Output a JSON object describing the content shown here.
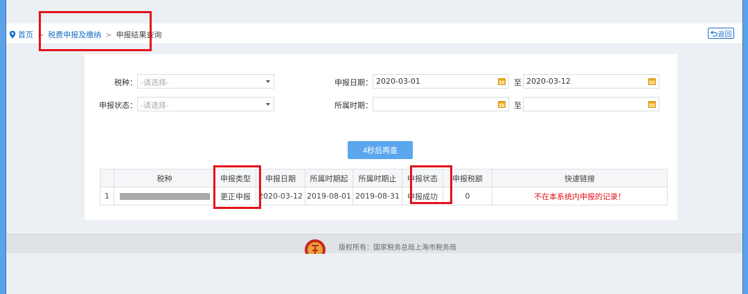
{
  "breadcrumb": {
    "home": "首页",
    "level1": "税费申报及缴纳",
    "current": "申报结果查询",
    "separator": ">"
  },
  "back_button": {
    "label": "返回"
  },
  "form": {
    "tax_type": {
      "label": "税种：",
      "placeholder": "-请选择-"
    },
    "decl_status": {
      "label": "申报状态：",
      "placeholder": "-请选择-"
    },
    "decl_date": {
      "label": "申报日期：",
      "from": "2020-03-01",
      "to": "2020-03-12",
      "to_label": "至"
    },
    "period": {
      "label": "所属时期：",
      "from": "",
      "to": "",
      "to_label": "至"
    }
  },
  "query_button": {
    "label": "4秒后再查"
  },
  "table": {
    "headers": [
      "",
      "税种",
      "申报类型",
      "申报日期",
      "所属时期起",
      "所属时期止",
      "申报状态",
      "申报税额",
      "快速链接"
    ],
    "rows": [
      {
        "index": "1",
        "tax_type": "",
        "decl_type": "更正申报",
        "decl_date": "2020-03-12",
        "period_start": "2019-08-01",
        "period_end": "2019-08-31",
        "status": "申报成功",
        "amount": "0",
        "link": "不在本系统内申报的记录！"
      }
    ]
  },
  "footer": {
    "copyright": "版权所有：国家税务总局上海市税务局"
  },
  "colors": {
    "accent": "#1a6fc9",
    "button": "#5aa7ee",
    "highlight": "#e3101a",
    "frame": "#5ea2e6"
  },
  "icons": [
    "location-pin-icon",
    "back-arrow-icon",
    "calendar-icon",
    "chevron-down-icon",
    "tax-emblem-icon"
  ]
}
